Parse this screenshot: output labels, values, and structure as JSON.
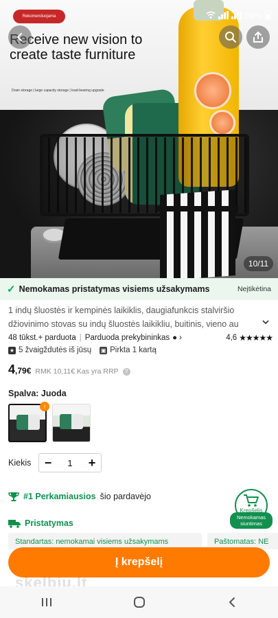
{
  "status_bar": {
    "battery": "59%"
  },
  "hero": {
    "tag": "Rekomenduojama",
    "title": "Receive new vision to create taste furniture",
    "subtitle": "Drain storage | large capacity storage | load-bearing upgrade",
    "counter": "10/11"
  },
  "shipping_banner": {
    "text": "Nemokamas pristatymas visiems užsakymams",
    "right": "Neįtikėtina"
  },
  "product": {
    "title_line1": "1 indų šluostės ir kempinės laikiklis, daugiafunkcis stalviršio",
    "title_line2": "džiovinimo stovas su indų šluostės laikikliu, buitinis, vieno au",
    "sold": "48 tūkst.+ parduota",
    "seller": "Parduoda prekybininkas",
    "rating": "4,6",
    "stars": "★★★★★",
    "reviews": "5 žvaigždutės iš jūsų",
    "bought": "Pirkta 1 kartą",
    "price_main": "4",
    "price_cents": ",79€",
    "old_price": "RMK 10,11€ Kas yra RRP",
    "info": "?"
  },
  "color": {
    "label": "Spalva: Juoda",
    "badge": "↑"
  },
  "quantity": {
    "label": "Kiekis",
    "minus": "−",
    "value": "1",
    "plus": "+"
  },
  "bestseller": {
    "rank": "#1 Perkamiausios",
    "from": "šio pardavėjo"
  },
  "cart_float": {
    "label": "Krepšelis",
    "pill": "Nemokamas siuntimas"
  },
  "delivery": {
    "title": "Pristatymas",
    "cards": [
      "Standartas: nemokamai visiems užsakymams",
      "Paštomatas: NE"
    ]
  },
  "cta": {
    "label": "Į krepšelį"
  },
  "watermark": "skelbiu.lt"
}
